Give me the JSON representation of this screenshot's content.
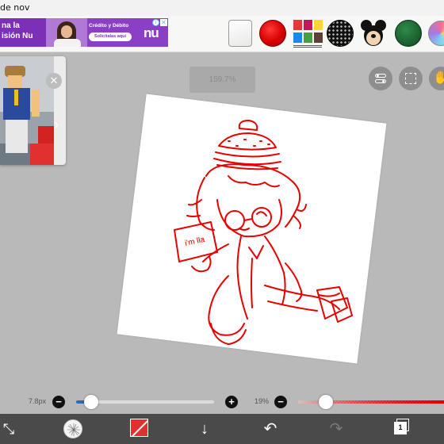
{
  "statusbar": {
    "time_partial": "de nov"
  },
  "ad": {
    "line1": "na la",
    "line2": "isión Nu",
    "tagline": "Crédito y Débito",
    "button_label": "Solicítalas aquí",
    "brand": "nu",
    "info_glyph": "i",
    "close_glyph": "✕",
    "color": "#8a3fc4"
  },
  "toolbar": {
    "palette_colors": [
      "#e53935",
      "#c2185b",
      "#fdd835",
      "#1e88e5",
      "#43a047",
      "#5d4037"
    ],
    "icons": [
      "white-paper-icon",
      "red-circle-icon",
      "color-palette-icon",
      "dot-pattern-icon",
      "mickey-icon",
      "green-circle-icon",
      "multicolor-ball-icon"
    ]
  },
  "reference": {
    "close_glyph": "✕",
    "next_glyph": "›"
  },
  "canvas": {
    "zoom_label": "159.7%",
    "rotation_deg": 7,
    "stroke_color": "#e60000",
    "sign_text": "i'm lla"
  },
  "float_buttons": {
    "icons": [
      "toggle-icon",
      "selection-icon",
      "hand-icon"
    ],
    "hand_glyph": "✋"
  },
  "brush": {
    "size_value": "7.8px",
    "size_fraction": 0.08,
    "minus_glyph": "−",
    "plus_glyph": "+"
  },
  "opacity": {
    "value": "19%",
    "fraction": 0.19,
    "minus_glyph": "−",
    "track_color": "#e60000"
  },
  "bottombar": {
    "transform_glyph": "⤡",
    "down_glyph": "↓",
    "undo_glyph": "↶",
    "redo_glyph": "↷",
    "layer_count": "1",
    "current_color": "#e23030"
  }
}
